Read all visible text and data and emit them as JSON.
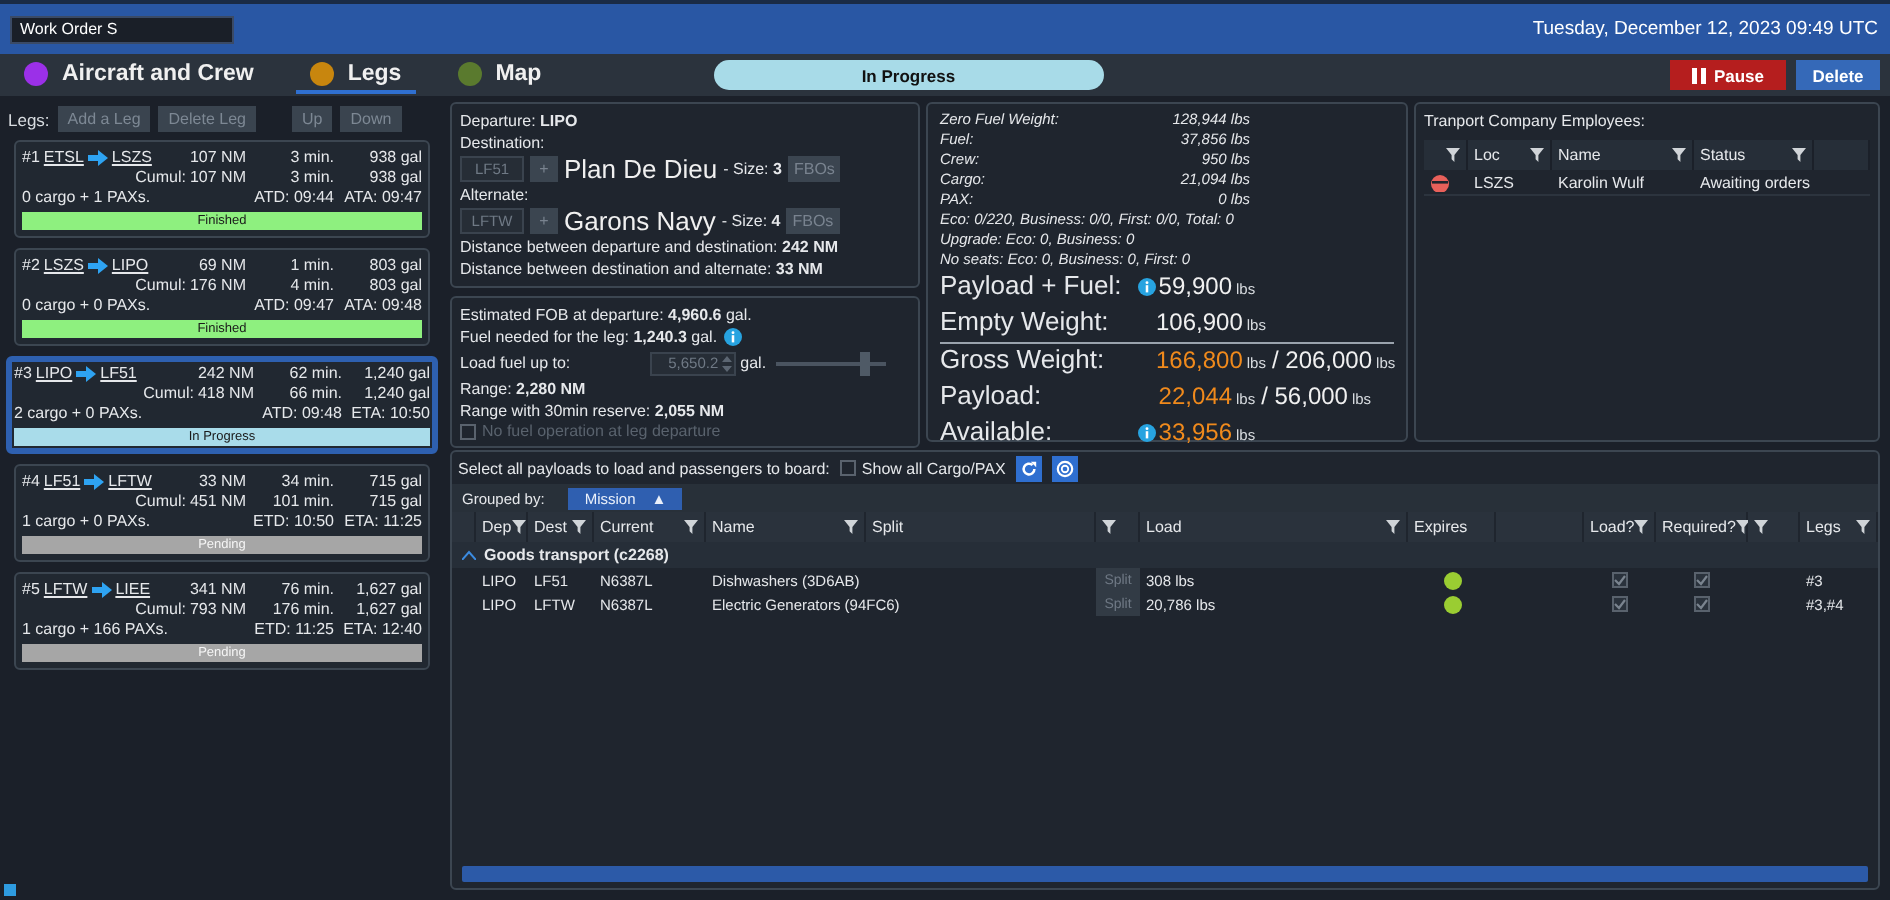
{
  "header": {
    "work_order": "Work Order S",
    "date": "Tuesday, December 12, 2023 09:49 UTC"
  },
  "tabs": [
    {
      "label": "Aircraft and Crew",
      "color": "#9b30e8",
      "selected": false
    },
    {
      "label": "Legs",
      "color": "#c8860e",
      "selected": true
    },
    {
      "label": "Map",
      "color": "#5a7a2e",
      "selected": false
    }
  ],
  "status": "In Progress",
  "actions": [
    {
      "label": "Pause",
      "kind": "pause"
    },
    {
      "label": "Delete",
      "kind": "delete"
    }
  ],
  "legs": {
    "label": "Legs:",
    "buttons": [
      {
        "label": "Add a Leg",
        "disabled": true
      },
      {
        "label": "Delete Leg",
        "disabled": true
      },
      {
        "label": "Up",
        "disabled": true
      },
      {
        "label": "Down",
        "disabled": true
      }
    ],
    "items": [
      {
        "number": "#1",
        "from": "ETSL",
        "to": "LSZS",
        "distance": "107 NM",
        "time": "3 min.",
        "fuel": "938 gal",
        "cumul_label": "Cumul:",
        "cumul_distance": "107 NM",
        "cumul_time": "3 min.",
        "cumul_fuel": "938 gal",
        "load": "0 cargo + 1 PAXs.",
        "departure": "ATD: 09:44",
        "arrival": "ATA: 09:47",
        "status": "Finished",
        "kind": "finished",
        "selected": false
      },
      {
        "number": "#2",
        "from": "LSZS",
        "to": "LIPO",
        "distance": "69 NM",
        "time": "1 min.",
        "fuel": "803 gal",
        "cumul_label": "Cumul:",
        "cumul_distance": "176 NM",
        "cumul_time": "4 min.",
        "cumul_fuel": "803 gal",
        "load": "0 cargo + 0 PAXs.",
        "departure": "ATD: 09:47",
        "arrival": "ATA: 09:48",
        "status": "Finished",
        "kind": "finished",
        "selected": false
      },
      {
        "number": "#3",
        "from": "LIPO",
        "to": "LF51",
        "distance": "242 NM",
        "time": "62 min.",
        "fuel": "1,240 gal",
        "cumul_label": "Cumul:",
        "cumul_distance": "418 NM",
        "cumul_time": "66 min.",
        "cumul_fuel": "1,240 gal",
        "load": "2 cargo + 0 PAXs.",
        "departure": "ATD: 09:48",
        "arrival": "ETA: 10:50",
        "status": "In Progress",
        "kind": "progress",
        "selected": true
      },
      {
        "number": "#4",
        "from": "LF51",
        "to": "LFTW",
        "distance": "33 NM",
        "time": "34 min.",
        "fuel": "715 gal",
        "cumul_label": "Cumul:",
        "cumul_distance": "451 NM",
        "cumul_time": "101 min.",
        "cumul_fuel": "715 gal",
        "load": "1 cargo + 0 PAXs.",
        "departure": "ETD: 10:50",
        "arrival": "ETA: 11:25",
        "status": "Pending",
        "kind": "pending",
        "selected": false
      },
      {
        "number": "#5",
        "from": "LFTW",
        "to": "LIEE",
        "distance": "341 NM",
        "time": "76 min.",
        "fuel": "1,627 gal",
        "cumul_label": "Cumul:",
        "cumul_distance": "793 NM",
        "cumul_time": "176 min.",
        "cumul_fuel": "1,627 gal",
        "load": "1 cargo + 166 PAXs.",
        "departure": "ETD: 11:25",
        "arrival": "ETA: 12:40",
        "status": "Pending",
        "kind": "pending",
        "selected": false
      }
    ]
  },
  "route": {
    "departure": "Departure: **LIPO**",
    "airports": [
      {
        "label": "Destination:",
        "code": "LF51",
        "add": "+",
        "name": "Plan De Dieu",
        "size": "- Size: **3**",
        "fbos": "FBOs"
      },
      {
        "label": "Alternate:",
        "code": "LFTW",
        "add": "+",
        "name": "Garons Navy",
        "size": "- Size: **4**",
        "fbos": "FBOs"
      }
    ],
    "lines": [
      "Distance between departure and destination: **242 NM**",
      "Distance between destination and alternate: **33 NM**"
    ]
  },
  "fuel": {
    "lines_top": [
      "Estimated FOB at departure: **4,960.6** gal.",
      "Fuel needed for the leg: **1,240.3** gal."
    ],
    "load_label": "Load fuel up to:",
    "load_value": "5,650.2",
    "load_unit": "gal.",
    "level": 0.8,
    "lines_bottom": [
      "Range: **2,280 NM**",
      "Range with 30min reserve: **2,055 NM**"
    ],
    "no_fuel": {
      "label": "No fuel operation at leg departure",
      "checked": false,
      "disabled": true
    }
  },
  "weights": {
    "small": [
      {
        "label": "Zero Fuel Weight:",
        "value": "128,944 lbs"
      },
      {
        "label": "Fuel:",
        "value": "37,856 lbs"
      },
      {
        "label": "Crew:",
        "value": "950 lbs"
      },
      {
        "label": "Cargo:",
        "value": "21,094 lbs"
      },
      {
        "label": "PAX:",
        "value": "0 lbs"
      }
    ],
    "notes": [
      "Eco: 0/220, Business: 0/0, First: 0/0, Total: 0",
      "Upgrade: Eco: 0, Business: 0",
      "No seats: Eco: 0, Business: 0, First: 0"
    ],
    "big": [
      {
        "label": "Payload + Fuel:",
        "info": true,
        "value": "59,900",
        "unit": "lbs",
        "highlight": false
      },
      {
        "label": "Empty Weight:",
        "info": false,
        "value": "106,900",
        "unit": "lbs",
        "highlight": false
      },
      {
        "label": "Gross Weight:",
        "info": false,
        "value": "166,800",
        "unit": "lbs",
        "limit": "/ 206,000",
        "limit_unit": "lbs",
        "highlight": true
      },
      {
        "label": "Payload:",
        "info": false,
        "value": "22,044",
        "unit": "lbs",
        "limit": "/ 56,000",
        "limit_unit": "lbs",
        "highlight": true
      },
      {
        "label": "Available:",
        "info": true,
        "value": "33,956",
        "unit": "lbs",
        "highlight": true
      }
    ]
  },
  "employees": {
    "title": "Tranport Company Employees:",
    "columns": [
      "Loc",
      "Name",
      "Status"
    ],
    "rows": [
      {
        "loc": "LSZS",
        "name": "Karolin Wulf",
        "status": "Awaiting orders"
      }
    ]
  },
  "payloads": {
    "title": "Select all payloads to load and passengers to board:",
    "show_all": {
      "label": "Show all Cargo/PAX",
      "checked": false
    },
    "grouped_label": "Grouped by:",
    "group_chip": "Mission",
    "group_arrow": "▲",
    "columns": [
      "Dep",
      "Dest",
      "Current",
      "Name",
      "Split",
      "Load",
      "Expires",
      "Load?",
      "Required?",
      "Legs"
    ],
    "groups": [
      {
        "label": "Goods transport (c2268)",
        "expanded": true,
        "rows": [
          {
            "dep": "LIPO",
            "dest": "LF51",
            "current": "N6387L",
            "name": "Dishwashers (3D6AB)",
            "split": "Split",
            "load": "308 lbs",
            "color": "#9acd32",
            "load_checked": true,
            "required_checked": true,
            "legs": "#3"
          },
          {
            "dep": "LIPO",
            "dest": "LFTW",
            "current": "N6387L",
            "name": "Electric Generators (94FC6)",
            "split": "Split",
            "load": "20,786 lbs",
            "color": "#9acd32",
            "load_checked": true,
            "required_checked": true,
            "legs": "#3,#4"
          }
        ]
      }
    ]
  }
}
